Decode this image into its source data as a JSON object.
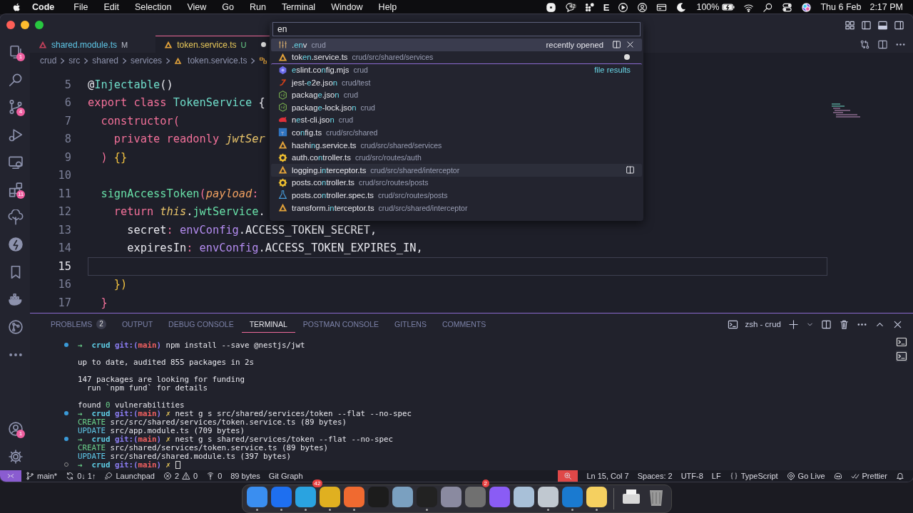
{
  "menubar": {
    "app": "Code",
    "menus": [
      "File",
      "Edit",
      "Selection",
      "View",
      "Go",
      "Run",
      "Terminal",
      "Window",
      "Help"
    ],
    "status_icons": [
      {
        "kind": "record"
      },
      {
        "kind": "chat",
        "badge": "42"
      },
      {
        "kind": "grid"
      },
      {
        "kind": "letter",
        "text": "E"
      },
      {
        "kind": "play"
      },
      {
        "kind": "person"
      },
      {
        "kind": "card"
      },
      {
        "kind": "moon"
      }
    ],
    "battery": "100%",
    "right_icons": [
      {
        "kind": "wifi"
      },
      {
        "kind": "search"
      },
      {
        "kind": "toggles"
      },
      {
        "kind": "orb"
      }
    ],
    "date": "Thu 6 Feb",
    "time": "2:17 PM"
  },
  "quick_open": {
    "query": "en",
    "items": [
      {
        "kind": "env",
        "name": ".**en**v",
        "path": "crud",
        "group": "recently opened",
        "selected": true,
        "hovered": false,
        "dirty": false
      },
      {
        "kind": "nest",
        "name": "tok**en**.service.ts",
        "path": "crud/src/shared/services",
        "selected": false,
        "hovered": false,
        "dirty": true
      },
      {
        "kind": "eslint",
        "name": "**e**slint.co**n**fig.mjs",
        "path": "crud",
        "group": "file results",
        "selected": false,
        "hovered": false,
        "dirty": false
      },
      {
        "kind": "jest",
        "name": "jest-**e**2e.jso**n**",
        "path": "crud/test",
        "selected": false,
        "hovered": false,
        "dirty": false
      },
      {
        "kind": "node",
        "name": "packag**e**.jso**n**",
        "path": "crud",
        "selected": false,
        "hovered": false,
        "dirty": false
      },
      {
        "kind": "node",
        "name": "packag**e**-lock.jso**n**",
        "path": "crud",
        "selected": false,
        "hovered": false,
        "dirty": false
      },
      {
        "kind": "cat",
        "name": "n**e**st-cli.jso**n**",
        "path": "crud",
        "selected": false,
        "hovered": false,
        "dirty": false
      },
      {
        "kind": "ts",
        "name": "co**n**fig.ts",
        "path": "crud/src/shared",
        "selected": false,
        "hovered": false,
        "dirty": false
      },
      {
        "kind": "nest",
        "name": "hashi**n**g.service.ts",
        "path": "crud/src/shared/services",
        "selected": false,
        "hovered": false,
        "dirty": false
      },
      {
        "kind": "gear",
        "name": "auth.co**n**troller.ts",
        "path": "crud/src/routes/auth",
        "selected": false,
        "hovered": false,
        "dirty": false
      },
      {
        "kind": "nest",
        "name": "logging.i**n**terceptor.ts",
        "path": "crud/src/shared/interceptor",
        "selected": false,
        "hovered": true,
        "dirty": false
      },
      {
        "kind": "gear",
        "name": "posts.co**n**troller.ts",
        "path": "crud/src/routes/posts",
        "selected": false,
        "hovered": false,
        "dirty": false
      },
      {
        "kind": "flask",
        "name": "posts.co**n**troller.spec.ts",
        "path": "crud/src/routes/posts",
        "selected": false,
        "hovered": false,
        "dirty": false
      },
      {
        "kind": "nest",
        "name": "transform.i**n**terceptor.ts",
        "path": "crud/src/shared/interceptor",
        "selected": false,
        "hovered": false,
        "dirty": false
      }
    ]
  },
  "activity_bar": [
    {
      "kind": "files",
      "badge": "1",
      "selected": false
    },
    {
      "kind": "search",
      "selected": false
    },
    {
      "kind": "branch",
      "badge": "4",
      "selected": false
    },
    {
      "kind": "debug",
      "selected": false
    },
    {
      "kind": "remote",
      "selected": false
    },
    {
      "kind": "extensions",
      "badge": "11",
      "selected": false
    },
    {
      "kind": "tree",
      "selected": false
    },
    {
      "kind": "bolt",
      "selected": false
    },
    {
      "kind": "bookmark",
      "selected": false
    },
    {
      "kind": "docker",
      "selected": false
    },
    {
      "kind": "graph",
      "selected": false
    },
    {
      "kind": "more",
      "selected": false
    }
  ],
  "activity_bottom": [
    {
      "kind": "account",
      "badge": "1"
    },
    {
      "kind": "gear"
    }
  ],
  "editor_tabs": [
    {
      "label": "shared.module.ts",
      "status": "M",
      "selected": false,
      "dirty": false
    },
    {
      "label": "token.service.ts",
      "status": "U",
      "selected": true,
      "dirty": true
    }
  ],
  "breadcrumb": [
    "crud",
    "src",
    "shared",
    "services",
    "token.service.ts"
  ],
  "code": [
    {
      "number": "5",
      "current": false,
      "tokens": [
        {
          "text": "@",
          "kind": "punc"
        },
        {
          "text": "Injectable",
          "kind": "fn"
        },
        {
          "text": "()",
          "kind": "punc"
        }
      ]
    },
    {
      "number": "6",
      "current": false,
      "tokens": [
        {
          "text": "export class ",
          "kind": "kw"
        },
        {
          "text": "TokenService",
          "kind": "fn"
        },
        {
          "text": " {",
          "kind": "punc"
        }
      ]
    },
    {
      "number": "7",
      "current": false,
      "tokens": [
        {
          "text": "  constructor(",
          "kind": "kw"
        }
      ]
    },
    {
      "number": "8",
      "current": false,
      "tokens": [
        {
          "text": "    private readonly ",
          "kind": "kw"
        },
        {
          "text": "jwtSer",
          "kind": "var"
        }
      ]
    },
    {
      "number": "9",
      "current": false,
      "tokens": [
        {
          "text": "  ) ",
          "kind": "kw"
        },
        {
          "text": "{}",
          "kind": "brace"
        }
      ]
    },
    {
      "number": "10",
      "current": false
    },
    {
      "number": "11",
      "current": false,
      "tokens": [
        {
          "text": "  signAccessToken",
          "kind": "method"
        },
        {
          "text": "(",
          "kind": "kw"
        },
        {
          "text": "payload",
          "kind": "param"
        },
        {
          "text": ":",
          "kind": "kw"
        }
      ]
    },
    {
      "number": "12",
      "current": false,
      "tokens": [
        {
          "text": "    return ",
          "kind": "kw"
        },
        {
          "text": "this",
          "kind": "var"
        },
        {
          "text": ".",
          "kind": "punc"
        },
        {
          "text": "jwtService",
          "kind": "method"
        },
        {
          "text": ".",
          "kind": "punc"
        }
      ]
    },
    {
      "number": "13",
      "current": false,
      "tokens": [
        {
          "text": "      secret",
          "kind": "punc"
        },
        {
          "text": ": ",
          "kind": "kw"
        },
        {
          "text": "envConfig",
          "kind": "obj"
        },
        {
          "text": ".ACCESS_TOKEN_SECRET,",
          "kind": "punc"
        }
      ]
    },
    {
      "number": "14",
      "current": false,
      "tokens": [
        {
          "text": "      expiresIn",
          "kind": "punc"
        },
        {
          "text": ": ",
          "kind": "kw"
        },
        {
          "text": "envConfig",
          "kind": "obj"
        },
        {
          "text": ".ACCESS_TOKEN_EXPIRES_IN,",
          "kind": "punc"
        }
      ]
    },
    {
      "number": "15",
      "current": true
    },
    {
      "number": "16",
      "current": false,
      "tokens": [
        {
          "text": "    })",
          "kind": "brace"
        }
      ]
    },
    {
      "number": "17",
      "current": false,
      "tokens": [
        {
          "text": "  }",
          "kind": "kw"
        }
      ]
    }
  ],
  "panel": {
    "tabs": [
      {
        "label": "PROBLEMS",
        "badge": "2",
        "selected": false
      },
      {
        "label": "OUTPUT",
        "selected": false
      },
      {
        "label": "DEBUG CONSOLE",
        "selected": false
      },
      {
        "label": "TERMINAL",
        "selected": true
      },
      {
        "label": "POSTMAN CONSOLE",
        "selected": false
      },
      {
        "label": "GITLENS",
        "selected": false
      },
      {
        "label": "COMMENTS",
        "selected": false
      }
    ],
    "terminal_name": "zsh - crud",
    "lines": [
      {
        "kind": "prompt",
        "succeeded": true,
        "segments": [
          {
            "text": "→ ",
            "kind": "arrow"
          },
          {
            "text": " crud ",
            "kind": "dir"
          },
          {
            "text": "git:(",
            "kind": "git"
          },
          {
            "text": "main",
            "kind": "branch"
          },
          {
            "text": ")",
            "kind": "git"
          },
          {
            "text": " npm install --save @nestjs/jwt",
            "kind": "plain"
          }
        ]
      },
      {
        "kind": "blank"
      },
      {
        "kind": "output",
        "segments": [
          {
            "text": "up to date, audited 855 packages in 2s",
            "kind": "plain"
          }
        ]
      },
      {
        "kind": "blank"
      },
      {
        "kind": "output",
        "segments": [
          {
            "text": "147 packages are looking for funding",
            "kind": "plain"
          }
        ]
      },
      {
        "kind": "output",
        "segments": [
          {
            "text": "  run `npm fund` for details",
            "kind": "plain"
          }
        ]
      },
      {
        "kind": "blank"
      },
      {
        "kind": "output",
        "segments": [
          {
            "text": "found ",
            "kind": "plain"
          },
          {
            "text": "0",
            "kind": "create"
          },
          {
            "text": " vulnerabilities",
            "kind": "plain"
          }
        ]
      },
      {
        "kind": "prompt",
        "succeeded": true,
        "segments": [
          {
            "text": "→ ",
            "kind": "arrow"
          },
          {
            "text": " crud ",
            "kind": "dir"
          },
          {
            "text": "git:(",
            "kind": "git"
          },
          {
            "text": "main",
            "kind": "branch"
          },
          {
            "text": ")",
            "kind": "git"
          },
          {
            "text": " ✗",
            "kind": "x"
          },
          {
            "text": " nest g s src/shared/services/token --flat --no-spec",
            "kind": "plain"
          }
        ]
      },
      {
        "kind": "output",
        "segments": [
          {
            "text": "CREATE",
            "kind": "create"
          },
          {
            "text": " src/src/shared/services/token.service.ts (89 bytes)",
            "kind": "plain"
          }
        ]
      },
      {
        "kind": "output",
        "segments": [
          {
            "text": "UPDATE",
            "kind": "update"
          },
          {
            "text": " src/app.module.ts (709 bytes)",
            "kind": "plain"
          }
        ]
      },
      {
        "kind": "prompt",
        "succeeded": true,
        "segments": [
          {
            "text": "→ ",
            "kind": "arrow"
          },
          {
            "text": " crud ",
            "kind": "dir"
          },
          {
            "text": "git:(",
            "kind": "git"
          },
          {
            "text": "main",
            "kind": "branch"
          },
          {
            "text": ")",
            "kind": "git"
          },
          {
            "text": " ✗",
            "kind": "x"
          },
          {
            "text": " nest g s shared/services/token --flat --no-spec",
            "kind": "plain"
          }
        ]
      },
      {
        "kind": "output",
        "segments": [
          {
            "text": "CREATE",
            "kind": "create"
          },
          {
            "text": " src/shared/services/token.service.ts (89 bytes)",
            "kind": "plain"
          }
        ]
      },
      {
        "kind": "output",
        "segments": [
          {
            "text": "UPDATE",
            "kind": "update"
          },
          {
            "text": " src/shared/shared.module.ts (397 bytes)",
            "kind": "plain"
          }
        ]
      },
      {
        "kind": "prompt",
        "succeeded": false,
        "cursor": true,
        "segments": [
          {
            "text": "→ ",
            "kind": "arrow"
          },
          {
            "text": " crud ",
            "kind": "dir"
          },
          {
            "text": "git:(",
            "kind": "git"
          },
          {
            "text": "main",
            "kind": "branch"
          },
          {
            "text": ")",
            "kind": "git"
          },
          {
            "text": " ✗",
            "kind": "x"
          }
        ]
      }
    ]
  },
  "status_bar": {
    "left": [
      {
        "kind": "remote"
      },
      {
        "kind": "branch",
        "text": "main*"
      },
      {
        "kind": "sync",
        "text": "0↓ 1↑"
      },
      {
        "kind": "launchpad",
        "text": "Launchpad"
      },
      {
        "kind": "problems",
        "errors": "2",
        "warnings": "0"
      },
      {
        "kind": "ports",
        "text": "0"
      },
      {
        "kind": "plain",
        "text": "89 bytes"
      },
      {
        "kind": "plain",
        "text": "Git Graph"
      }
    ],
    "right": [
      {
        "kind": "zoom"
      },
      {
        "kind": "plain",
        "text": "Ln 15, Col 7"
      },
      {
        "kind": "plain",
        "text": "Spaces: 2"
      },
      {
        "kind": "plain",
        "text": "UTF-8"
      },
      {
        "kind": "plain",
        "text": "LF"
      },
      {
        "kind": "braces",
        "text": "TypeScript"
      },
      {
        "kind": "golive",
        "text": "Go Live"
      },
      {
        "kind": "copilot"
      },
      {
        "kind": "prettier",
        "text": "Prettier"
      },
      {
        "kind": "bell"
      }
    ]
  },
  "dock": [
    {
      "kind": "app",
      "color": "#3a8ef0",
      "running": true
    },
    {
      "kind": "app",
      "color": "#1e6ff0",
      "running": true
    },
    {
      "kind": "app",
      "color": "#2aa3e0",
      "running": true,
      "badge": "42"
    },
    {
      "kind": "app",
      "color": "#e0b020",
      "running": true
    },
    {
      "kind": "app",
      "color": "#f06a30",
      "running": true
    },
    {
      "kind": "app",
      "color": "#1c1c1c",
      "running": false
    },
    {
      "kind": "app",
      "color": "#7aa0c0",
      "running": false
    },
    {
      "kind": "app",
      "color": "#222222",
      "running": true
    },
    {
      "kind": "app",
      "color": "#8a8aa0",
      "running": false
    },
    {
      "kind": "app",
      "color": "#707070",
      "running": false,
      "badge": "2"
    },
    {
      "kind": "app",
      "color": "#8a5cf5",
      "running": false
    },
    {
      "kind": "app",
      "color": "#a8c0d8",
      "running": false
    },
    {
      "kind": "app",
      "color": "#c0c8d0",
      "running": true
    },
    {
      "kind": "app",
      "color": "#1a7ad0",
      "running": true
    },
    {
      "kind": "app",
      "color": "#f5d060",
      "running": true
    },
    {
      "kind": "divider"
    },
    {
      "kind": "printer",
      "color": "#d8d8d8"
    },
    {
      "kind": "trash",
      "color": "#9a9a9a"
    }
  ]
}
